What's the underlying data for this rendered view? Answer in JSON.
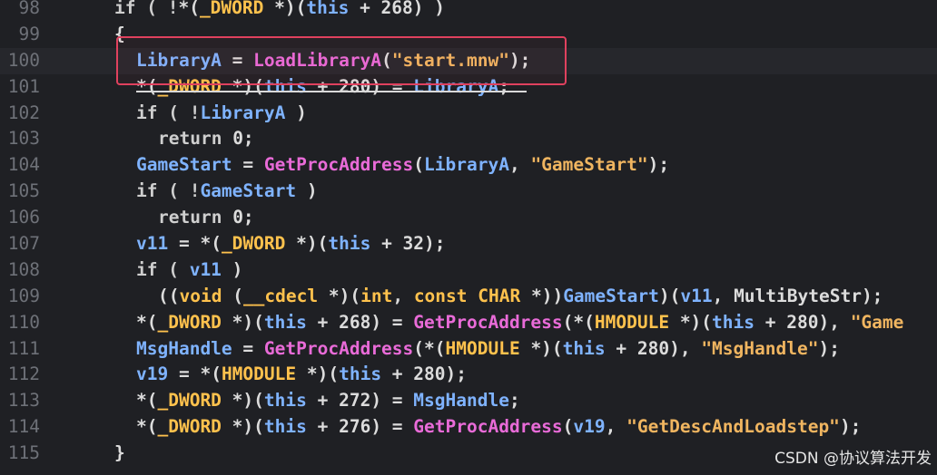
{
  "editor": {
    "lines": [
      {
        "no": "98",
        "indent": 0,
        "tokens": [
          [
            "kw",
            "if ( !"
          ],
          [
            "pl",
            "*("
          ],
          [
            "ty",
            "_DWORD"
          ],
          [
            "pl",
            " *)("
          ],
          [
            "id",
            "this"
          ],
          [
            "pl",
            " + 268) )"
          ]
        ]
      },
      {
        "no": "99",
        "indent": 0,
        "tokens": [
          [
            "pl",
            "{"
          ]
        ]
      },
      {
        "no": "100",
        "indent": 1,
        "tokens": [
          [
            "id",
            "LibraryA"
          ],
          [
            "pl",
            " = "
          ],
          [
            "fn",
            "LoadLibraryA"
          ],
          [
            "pl",
            "("
          ],
          [
            "st",
            "\"start.mnw\""
          ],
          [
            "pl",
            ");"
          ]
        ]
      },
      {
        "no": "101",
        "indent": 1,
        "tokens": [
          [
            "pl",
            "*("
          ],
          [
            "ty",
            "_DWORD"
          ],
          [
            "pl",
            " *)("
          ],
          [
            "id",
            "this"
          ],
          [
            "pl",
            " + 280) = "
          ],
          [
            "id",
            "LibraryA"
          ],
          [
            "pl",
            ";"
          ]
        ]
      },
      {
        "no": "102",
        "indent": 1,
        "tokens": [
          [
            "kw",
            "if ( !"
          ],
          [
            "id",
            "LibraryA"
          ],
          [
            "pl",
            " )"
          ]
        ]
      },
      {
        "no": "103",
        "indent": 2,
        "tokens": [
          [
            "kw",
            "return"
          ],
          [
            "pl",
            " 0;"
          ]
        ]
      },
      {
        "no": "104",
        "indent": 1,
        "tokens": [
          [
            "id",
            "GameStart"
          ],
          [
            "pl",
            " = "
          ],
          [
            "fn",
            "GetProcAddress"
          ],
          [
            "pl",
            "("
          ],
          [
            "id",
            "LibraryA"
          ],
          [
            "pl",
            ", "
          ],
          [
            "st",
            "\"GameStart\""
          ],
          [
            "pl",
            ");"
          ]
        ]
      },
      {
        "no": "105",
        "indent": 1,
        "tokens": [
          [
            "kw",
            "if ( !"
          ],
          [
            "id",
            "GameStart"
          ],
          [
            "pl",
            " )"
          ]
        ]
      },
      {
        "no": "106",
        "indent": 2,
        "tokens": [
          [
            "kw",
            "return"
          ],
          [
            "pl",
            " 0;"
          ]
        ]
      },
      {
        "no": "107",
        "indent": 1,
        "tokens": [
          [
            "id",
            "v11"
          ],
          [
            "pl",
            " = *("
          ],
          [
            "ty",
            "_DWORD"
          ],
          [
            "pl",
            " *)("
          ],
          [
            "id",
            "this"
          ],
          [
            "pl",
            " + 32);"
          ]
        ]
      },
      {
        "no": "108",
        "indent": 1,
        "tokens": [
          [
            "kw",
            "if ( "
          ],
          [
            "id",
            "v11"
          ],
          [
            "pl",
            " )"
          ]
        ]
      },
      {
        "no": "109",
        "indent": 2,
        "tokens": [
          [
            "pl",
            "(("
          ],
          [
            "ty",
            "void"
          ],
          [
            "pl",
            " ("
          ],
          [
            "ty",
            "__cdecl"
          ],
          [
            "pl",
            " *)("
          ],
          [
            "ty",
            "int"
          ],
          [
            "pl",
            ", "
          ],
          [
            "ty",
            "const CHAR"
          ],
          [
            "pl",
            " *))"
          ],
          [
            "id",
            "GameStart"
          ],
          [
            "pl",
            ")("
          ],
          [
            "id",
            "v11"
          ],
          [
            "pl",
            ", "
          ],
          [
            "pl",
            "MultiByteStr);"
          ]
        ]
      },
      {
        "no": "110",
        "indent": 1,
        "tokens": [
          [
            "pl",
            "*("
          ],
          [
            "ty",
            "_DWORD"
          ],
          [
            "pl",
            " *)("
          ],
          [
            "id",
            "this"
          ],
          [
            "pl",
            " + 268) = "
          ],
          [
            "fn",
            "GetProcAddress"
          ],
          [
            "pl",
            "(*("
          ],
          [
            "ty",
            "HMODULE"
          ],
          [
            "pl",
            " *)("
          ],
          [
            "id",
            "this"
          ],
          [
            "pl",
            " + 280), "
          ],
          [
            "st",
            "\"Game"
          ]
        ]
      },
      {
        "no": "111",
        "indent": 1,
        "tokens": [
          [
            "id",
            "MsgHandle"
          ],
          [
            "pl",
            " = "
          ],
          [
            "fn",
            "GetProcAddress"
          ],
          [
            "pl",
            "(*("
          ],
          [
            "ty",
            "HMODULE"
          ],
          [
            "pl",
            " *)("
          ],
          [
            "id",
            "this"
          ],
          [
            "pl",
            " + 280), "
          ],
          [
            "st",
            "\"MsgHandle\""
          ],
          [
            "pl",
            ");"
          ]
        ]
      },
      {
        "no": "112",
        "indent": 1,
        "tokens": [
          [
            "id",
            "v19"
          ],
          [
            "pl",
            " = *("
          ],
          [
            "ty",
            "HMODULE"
          ],
          [
            "pl",
            " *)("
          ],
          [
            "id",
            "this"
          ],
          [
            "pl",
            " + 280);"
          ]
        ]
      },
      {
        "no": "113",
        "indent": 1,
        "tokens": [
          [
            "pl",
            "*("
          ],
          [
            "ty",
            "_DWORD"
          ],
          [
            "pl",
            " *)("
          ],
          [
            "id",
            "this"
          ],
          [
            "pl",
            " + 272) = "
          ],
          [
            "id",
            "MsgHandle"
          ],
          [
            "pl",
            ";"
          ]
        ]
      },
      {
        "no": "114",
        "indent": 1,
        "tokens": [
          [
            "pl",
            "*("
          ],
          [
            "ty",
            "_DWORD"
          ],
          [
            "pl",
            " *)("
          ],
          [
            "id",
            "this"
          ],
          [
            "pl",
            " + 276) = "
          ],
          [
            "fn",
            "GetProcAddress"
          ],
          [
            "pl",
            "("
          ],
          [
            "id",
            "v19"
          ],
          [
            "pl",
            ", "
          ],
          [
            "st",
            "\"GetDescAndLoadstep\""
          ],
          [
            "pl",
            ");"
          ]
        ]
      },
      {
        "no": "115",
        "indent": 0,
        "tokens": [
          [
            "pl",
            "}"
          ]
        ]
      }
    ],
    "current_line": "100"
  },
  "watermark": "CSDN @协议算法开发",
  "colors": {
    "background": "#1f2024",
    "highlight_box": "#e0415e",
    "keyword": "#cfcfcf",
    "identifier": "#7fb3ff",
    "function": "#e96bd8",
    "type": "#ffc24d",
    "string": "#f0b560"
  }
}
